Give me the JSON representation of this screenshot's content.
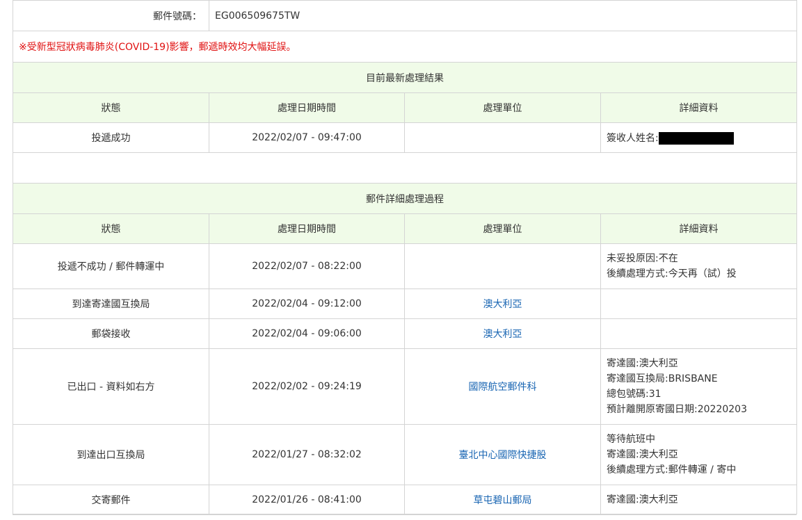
{
  "tracking": {
    "label": "郵件號碼：",
    "number": "EG006509675TW"
  },
  "notice": "※受新型冠狀病毒肺炎(COVID-19)影響，郵遞時效均大幅延誤。",
  "latest": {
    "title": "目前最新處理結果",
    "headers": [
      "狀態",
      "處理日期時間",
      "處理單位",
      "詳細資料"
    ],
    "row": {
      "status": "投遞成功",
      "datetime": "2022/02/07 - 09:47:00",
      "unit": "",
      "detail_label": "簽收人姓名:"
    }
  },
  "history": {
    "title": "郵件詳細處理過程",
    "headers": [
      "狀態",
      "處理日期時間",
      "處理單位",
      "詳細資料"
    ],
    "rows": [
      {
        "status": "投遞不成功 / 郵件轉運中",
        "datetime": "2022/02/07 - 08:22:00",
        "unit": "",
        "details": [
          "未妥投原因:不在",
          "後續處理方式:今天再（試）投"
        ]
      },
      {
        "status": "到達寄達國互換局",
        "datetime": "2022/02/04 - 09:12:00",
        "unit": "澳大利亞",
        "details": []
      },
      {
        "status": "郵袋接收",
        "datetime": "2022/02/04 - 09:06:00",
        "unit": "澳大利亞",
        "details": []
      },
      {
        "status": "已出口 - 資料如右方",
        "datetime": "2022/02/02 - 09:24:19",
        "unit": "國際航空郵件科",
        "details": [
          "寄達國:澳大利亞",
          "寄達國互換局:BRISBANE",
          "總包號碼:31",
          "預計離開原寄國日期:20220203"
        ]
      },
      {
        "status": "到達出口互換局",
        "datetime": "2022/01/27 - 08:32:02",
        "unit": "臺北中心國際快捷股",
        "details": [
          "等待航班中",
          "寄達國:澳大利亞",
          "後續處理方式:郵件轉運 / 寄中"
        ]
      },
      {
        "status": "交寄郵件",
        "datetime": "2022/01/26 - 08:41:00",
        "unit": "草屯碧山郵局",
        "details": [
          "寄達國:澳大利亞"
        ]
      }
    ]
  },
  "colors": {
    "header_bg": "#f0fbe8",
    "border": "#d4d4d4",
    "notice": "#e01010",
    "link": "#1a66b3"
  }
}
